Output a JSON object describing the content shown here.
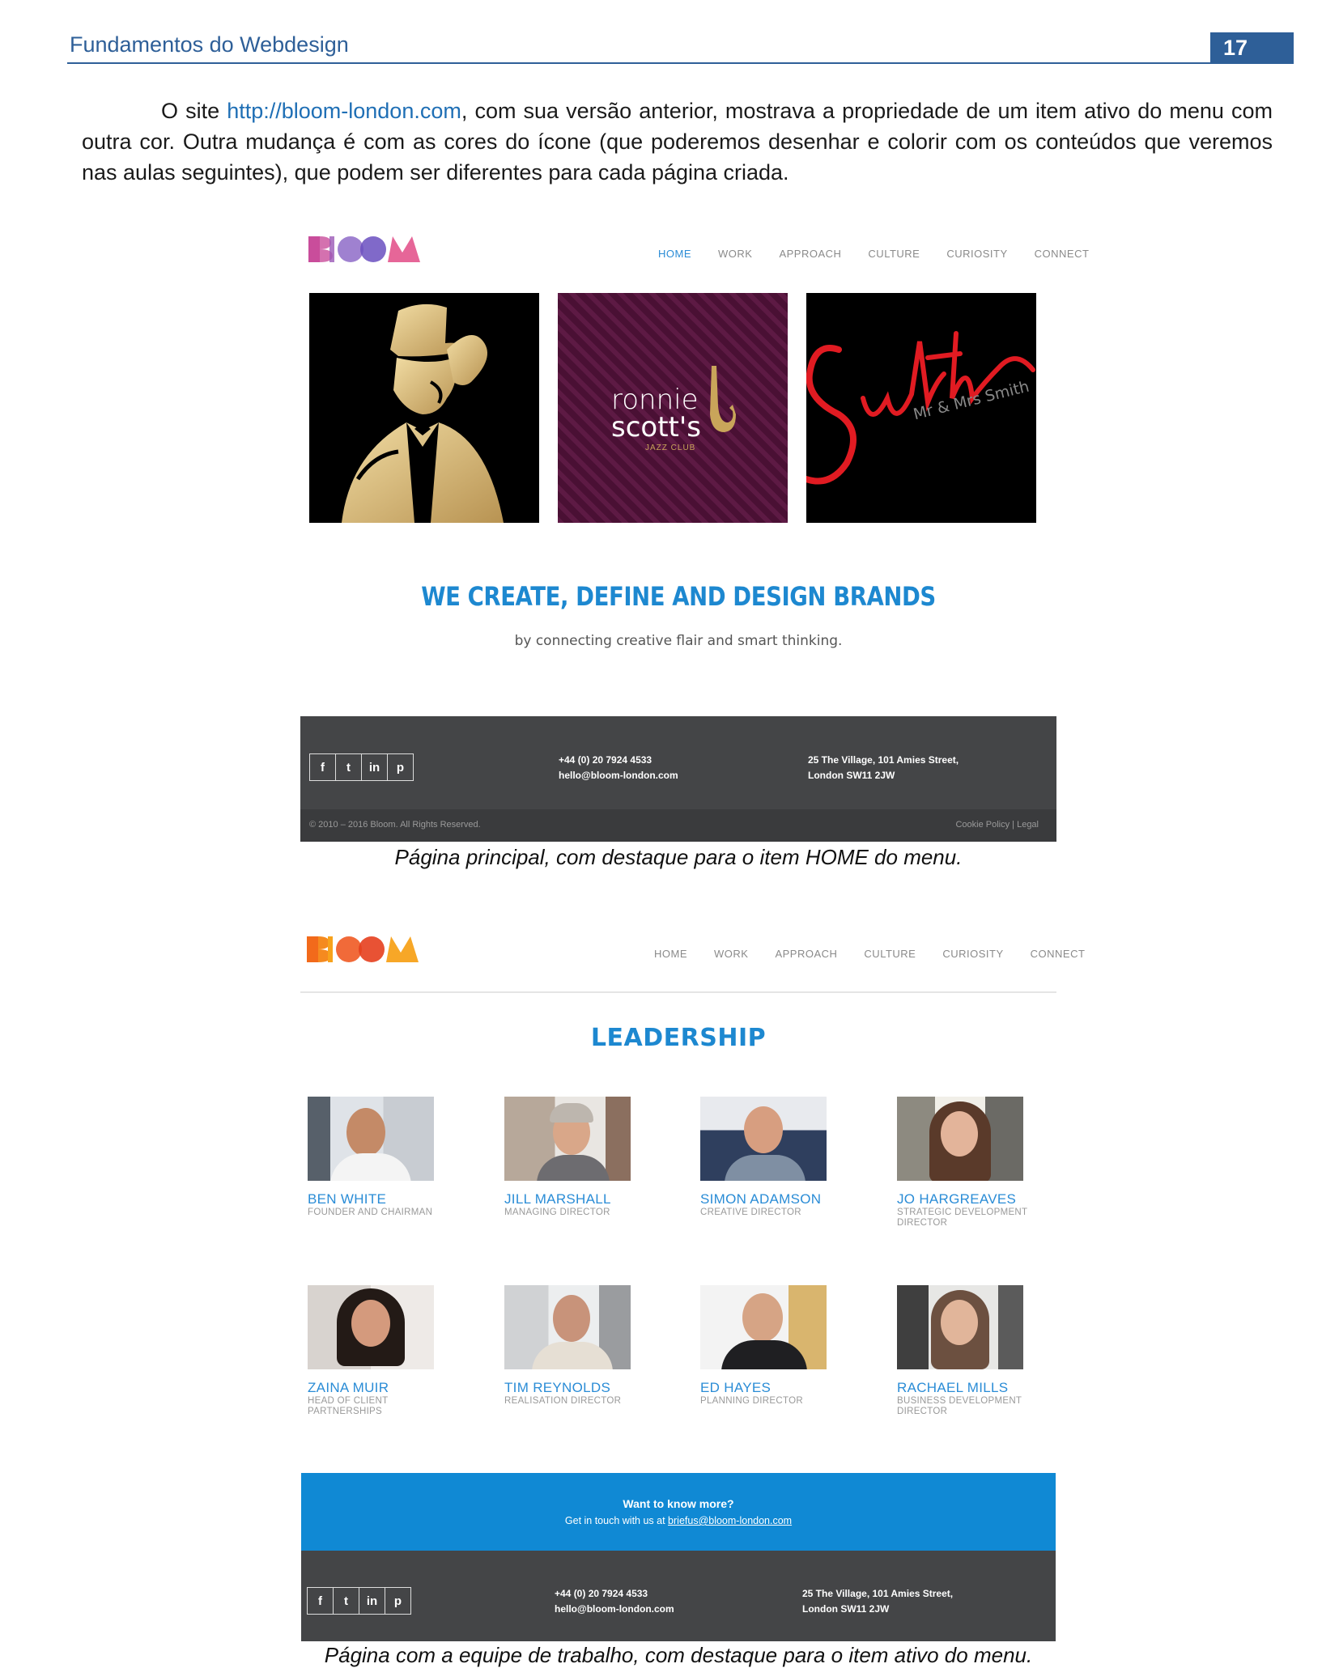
{
  "header": {
    "title": "Fundamentos do Webdesign",
    "page_number": "17"
  },
  "intro": {
    "part1": "O site ",
    "link": "http://bloom-london.com",
    "part2": ", com sua versão anterior, mostrava a propriedade de um item ativo do menu com outra cor. Outra mudança é com as cores do ícone (que poderemos desenhar e colorir com os conteúdos que veremos nas aulas seguintes), que podem ser diferentes para cada página criada."
  },
  "shot1": {
    "logo": "BLOOM",
    "nav": [
      "HOME",
      "WORK",
      "APPROACH",
      "CULTURE",
      "CURIOSITY",
      "CONNECT"
    ],
    "active_nav": "HOME",
    "tiles": [
      {
        "name": "gentleman-illustration"
      },
      {
        "title1": "ronnie",
        "title2": "scott's",
        "sub": "JAZZ CLUB"
      },
      {
        "script": "Smith",
        "sub": "Mr & Mrs Smith"
      }
    ],
    "headline": "WE CREATE, DEFINE AND DESIGN BRANDS",
    "subline": "by connecting creative flair and smart thinking.",
    "footer": {
      "social": [
        "f",
        "t",
        "in",
        "p"
      ],
      "phone": "+44 (0) 20 7924 4533",
      "email": "hello@bloom-london.com",
      "address1": "25 The Village, 101 Amies Street,",
      "address2": "London SW11 2JW",
      "copyright": "© 2010 – 2016 Bloom. All Rights Reserved.",
      "legal": "Cookie Policy | Legal"
    },
    "caption": "Página principal, com destaque para o item HOME do menu."
  },
  "shot2": {
    "logo": "BLOOM",
    "nav": [
      "HOME",
      "WORK",
      "APPROACH",
      "CULTURE",
      "CURIOSITY",
      "CONNECT"
    ],
    "title": "LEADERSHIP",
    "people": [
      {
        "name": "BEN WHITE",
        "role": "FOUNDER AND CHAIRMAN"
      },
      {
        "name": "JILL MARSHALL",
        "role": "MANAGING DIRECTOR"
      },
      {
        "name": "SIMON ADAMSON",
        "role": "CREATIVE DIRECTOR"
      },
      {
        "name": "JO HARGREAVES",
        "role": "STRATEGIC DEVELOPMENT DIRECTOR"
      },
      {
        "name": "ZAINA MUIR",
        "role": "HEAD OF CLIENT PARTNERSHIPS"
      },
      {
        "name": "TIM REYNOLDS",
        "role": "REALISATION DIRECTOR"
      },
      {
        "name": "ED HAYES",
        "role": "PLANNING DIRECTOR"
      },
      {
        "name": "RACHAEL MILLS",
        "role": "BUSINESS DEVELOPMENT DIRECTOR"
      }
    ],
    "banner": {
      "title": "Want to know more?",
      "text": "Get in touch with us at ",
      "email": "briefus@bloom-london.com"
    },
    "footer": {
      "social": [
        "f",
        "t",
        "in",
        "p"
      ],
      "phone": "+44 (0) 20 7924 4533",
      "email": "hello@bloom-london.com",
      "address1": "25 The Village, 101 Amies Street,",
      "address2": "London SW11 2JW"
    },
    "caption": "Página com a equipe de trabalho, com destaque para o item ativo do menu."
  }
}
